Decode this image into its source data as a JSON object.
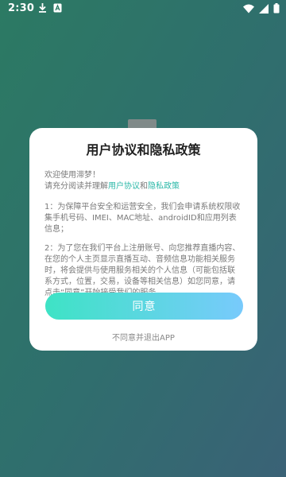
{
  "status_bar": {
    "time": "2:30",
    "icons": [
      "download-icon",
      "a-letter-icon",
      "wifi-icon",
      "signal-icon",
      "battery-icon"
    ]
  },
  "dialog": {
    "title": "用户协议和隐私政策",
    "welcome": "欢迎使用滞梦！",
    "read_prefix": "请充分阅读并理解",
    "user_agreement_link": "用户协议",
    "and": "和",
    "privacy_policy_link": "隐私政策",
    "paragraph1": "1：为保障平台安全和运营安全，我们会申请系统权限收集手机号码、IMEI、MAC地址、androidID和应用列表信息；",
    "paragraph2": "2：为了您在我们平台上注册账号、向您推荐直播内容、在您的个人主页显示直播互动、音频信息功能相关服务时，将会提供与使用服务相关的个人信息（可能包括联系方式，位置，交易，设备等相关信息）如您同意，请点击“同意”开始接受我们的服务",
    "agree_label": "同意",
    "disagree_label": "不同意并退出APP"
  },
  "colors": {
    "accent_link": "#2bb8a8",
    "button_gradient_start": "#3ee3c5",
    "button_gradient_end": "#78cafc"
  }
}
